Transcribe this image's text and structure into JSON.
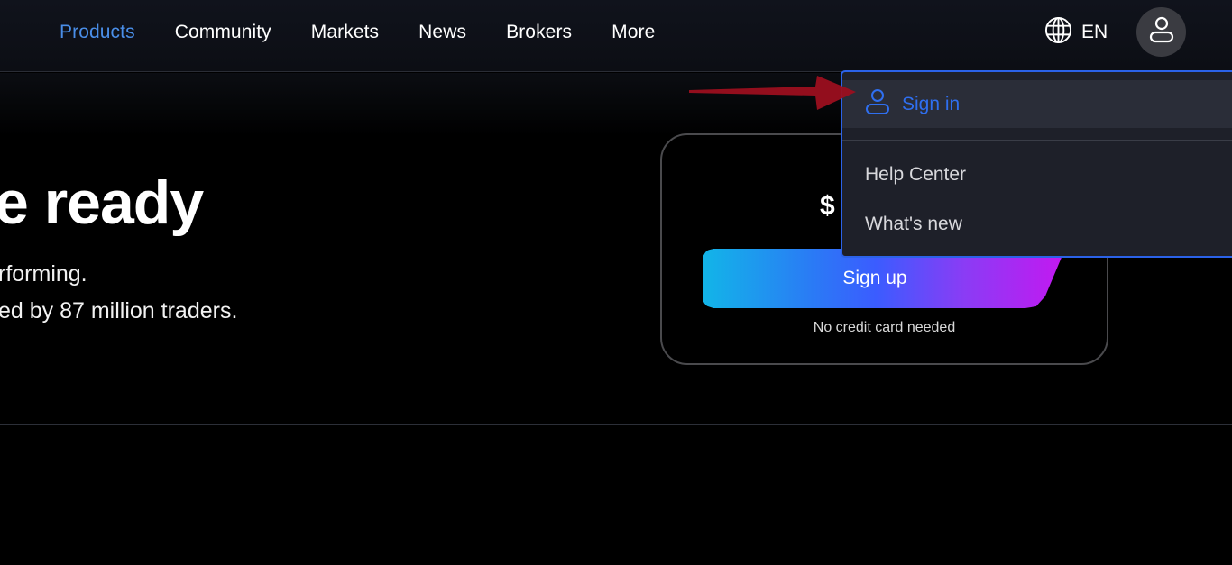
{
  "header": {
    "nav": [
      {
        "label": "Products",
        "active": true
      },
      {
        "label": "Community",
        "active": false
      },
      {
        "label": "Markets",
        "active": false
      },
      {
        "label": "News",
        "active": false
      },
      {
        "label": "Brokers",
        "active": false
      },
      {
        "label": "More",
        "active": false
      }
    ],
    "language": {
      "icon": "globe-icon",
      "label": "EN"
    },
    "user_button": {
      "icon": "user-icon"
    }
  },
  "hero": {
    "title_fragment": "e ready",
    "subtitle_line1": "rforming.",
    "subtitle_line2": "ed by 87 million traders."
  },
  "card": {
    "price_fragment": "$",
    "signup_label": "Sign up",
    "note": "No credit card needed"
  },
  "dropdown": {
    "signin": {
      "icon": "user-icon",
      "label": "Sign in"
    },
    "items": [
      {
        "label": "Help Center"
      },
      {
        "label": "What's new"
      }
    ]
  },
  "annotation": {
    "type": "arrow",
    "color": "#9b0f1f",
    "points_to": "Sign in"
  },
  "colors": {
    "accent_blue": "#2f6ff0",
    "active_nav": "#4a8ee8",
    "dropdown_border": "#2b62e8",
    "background": "#000000"
  }
}
